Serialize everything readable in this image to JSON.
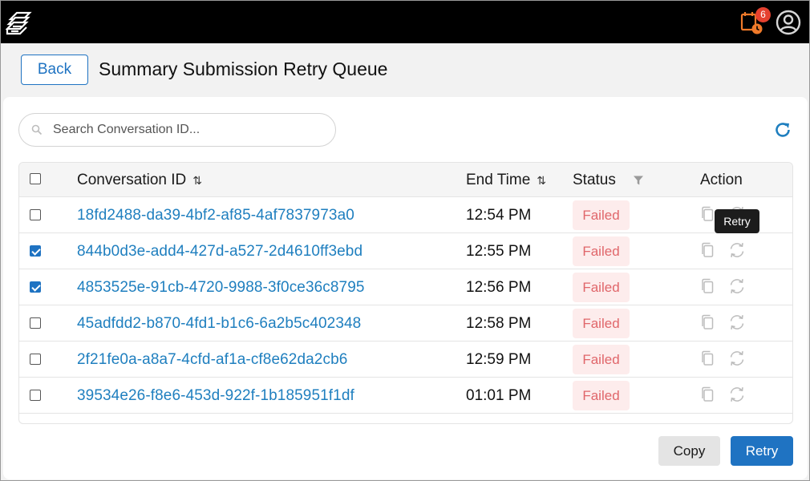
{
  "header": {
    "logo_icon": "layered-pages-logo-icon",
    "notification_icon": "calendar-clock-icon",
    "notification_count": "6",
    "avatar_icon": "user-circle-icon"
  },
  "page": {
    "back_label": "Back",
    "title": "Summary Submission Retry Queue"
  },
  "search": {
    "placeholder": "Search Conversation ID...",
    "value": ""
  },
  "table": {
    "columns": {
      "conversation_id": "Conversation ID",
      "end_time": "End Time",
      "status": "Status",
      "action": "Action"
    },
    "sort_glyph": "⇅",
    "rows": [
      {
        "id": "18fd2488-da39-4bf2-af85-4af7837973a0",
        "end_time": "12:54 PM",
        "status": "Failed",
        "checked": false
      },
      {
        "id": "844b0d3e-add4-427d-a527-2d4610ff3ebd",
        "end_time": "12:55 PM",
        "status": "Failed",
        "checked": true
      },
      {
        "id": "4853525e-91cb-4720-9988-3f0ce36c8795",
        "end_time": "12:56 PM",
        "status": "Failed",
        "checked": true
      },
      {
        "id": "45adfdd2-b870-4fd1-b1c6-6a2b5c402348",
        "end_time": "12:58 PM",
        "status": "Failed",
        "checked": false
      },
      {
        "id": "2f21fe0a-a8a7-4cfd-af1a-cf8e62da2cb6",
        "end_time": "12:59 PM",
        "status": "Failed",
        "checked": false
      },
      {
        "id": "39534e26-f8e6-453d-922f-1b185951f1df",
        "end_time": "01:01 PM",
        "status": "Failed",
        "checked": false
      }
    ]
  },
  "tooltip": {
    "text": "Retry"
  },
  "footer": {
    "copy_label": "Copy",
    "retry_label": "Retry"
  },
  "colors": {
    "accent": "#1f73c2",
    "link": "#1f7fbf",
    "failed_text": "#e0666a",
    "failed_bg": "#fdecec",
    "notification": "#f07a2a",
    "badge": "#e5412f"
  }
}
